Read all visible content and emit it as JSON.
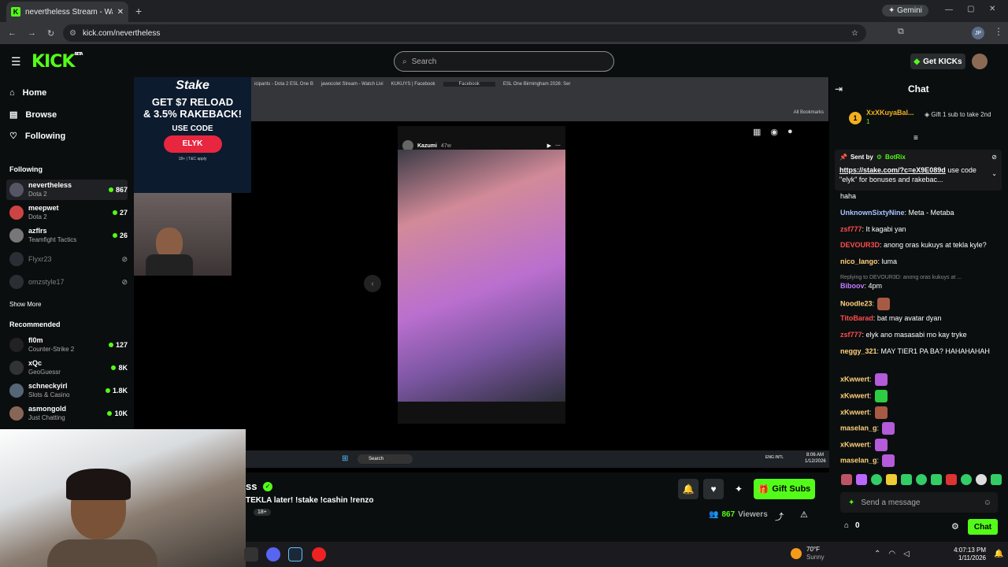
{
  "browser": {
    "tab_title": "nevertheless Stream - Watch Li",
    "url": "kick.com/nevertheless",
    "gemini_label": "Gemini",
    "profile_initials": "JP"
  },
  "header": {
    "logo": "KICK",
    "logo_badge": "BETA",
    "search_placeholder": "Search",
    "get_kicks_label": "Get KICKs"
  },
  "sidebar": {
    "nav": [
      {
        "label": "Home"
      },
      {
        "label": "Browse"
      },
      {
        "label": "Following"
      }
    ],
    "following_heading": "Following",
    "following": [
      {
        "name": "nevertheless",
        "category": "Dota 2",
        "viewers": "867",
        "live": true
      },
      {
        "name": "meepwet",
        "category": "Dota 2",
        "viewers": "27",
        "live": true
      },
      {
        "name": "azflrs",
        "category": "Teamfight Tactics",
        "viewers": "26",
        "live": true
      },
      {
        "name": "Flyxr23",
        "category": "",
        "viewers": "",
        "live": false
      },
      {
        "name": "omzstyle17",
        "category": "",
        "viewers": "",
        "live": false
      }
    ],
    "show_more": "Show More",
    "recommended_heading": "Recommended",
    "recommended": [
      {
        "name": "fl0m",
        "category": "Counter-Strike 2",
        "viewers": "127"
      },
      {
        "name": "xQc",
        "category": "GeoGuessr",
        "viewers": "8K"
      },
      {
        "name": "schneckyirl",
        "category": "Slots & Casino",
        "viewers": "1.8K"
      },
      {
        "name": "asmongold",
        "category": "Just Chatting",
        "viewers": "10K"
      }
    ]
  },
  "ad": {
    "brand": "Stake",
    "line1": "GET $7 RELOAD",
    "line2": "& 3.5% RAKEBACK!",
    "use_code": "USE CODE",
    "code": "ELYK",
    "fine_print": "18+ | T&C apply"
  },
  "stream_overlay": {
    "inner_tabs": [
      "icipants - Dota 2 ESL One B",
      "jawocolet Stream - Watch Livi",
      "KUKUYS | Facebook",
      "Facebook",
      "ESL One Birmingham 2026: Ser"
    ],
    "bookmarks": "All Bookmarks",
    "post_author": "Kazumi",
    "post_time": "47w",
    "taskbar_search": "Search",
    "taskbar_time": "8:06 AM",
    "taskbar_date": "1/12/2026",
    "taskbar_lang": "ENG INTL"
  },
  "stream_info": {
    "channel_name_partial": "ss",
    "title": "TEKLA later! !stake !cashin !renzo",
    "age_badge": "18+",
    "viewers": "867",
    "viewers_label": "Viewers",
    "gift_subs_label": "Gift Subs"
  },
  "chat": {
    "heading": "Chat",
    "top_gifter": {
      "rank": "1",
      "name": "XxXKuyaBal...",
      "count": "1",
      "note": "Gift 1 sub to take 2nd"
    },
    "pinned": {
      "sent_by": "Sent by",
      "bot": "BotRix",
      "link": "https://stake.com/?c=eX9E089d",
      "text": " use code \"elyk\" for bonuses and rakebac..."
    },
    "messages": [
      {
        "user": "",
        "text": "haha",
        "color": "#ffffff"
      },
      {
        "user": "UnknownSixtyNine",
        "text": ": Meta - Metaba",
        "color": "#a8c5ff"
      },
      {
        "user": "zsf777",
        "text": ": It kagabi yan",
        "color": "#ff4d4d"
      },
      {
        "user": "DEVOUR3D",
        "text": ": anong oras kukuys at tekla kyle?",
        "color": "#ff4d4d"
      },
      {
        "user": "nico_lango",
        "text": ": luma",
        "color": "#ffd27a"
      },
      {
        "user": "Replying to DEVOUR3D: anong oras kukuys at ...",
        "text": "",
        "color": "#888888"
      },
      {
        "user": "Biboov",
        "text": ": 4pm",
        "color": "#c27bff"
      },
      {
        "user": "Noodle23",
        "text": ":",
        "color": "#ffd27a"
      },
      {
        "user": "TitoBarad",
        "text": ": bat may avatar dyan",
        "color": "#ff4d4d"
      },
      {
        "user": "zsf777",
        "text": ": elyk ano masasabi mo kay tryke",
        "color": "#ff4d4d"
      },
      {
        "user": "neggy_321",
        "text": ": MAY TIER1 PA BA? HAHAHAHAH",
        "color": "#ffd27a"
      },
      {
        "user": "xKwwert",
        "text": ":",
        "color": "#ffd27a"
      },
      {
        "user": "xKwwert",
        "text": ":",
        "color": "#ffd27a"
      },
      {
        "user": "xKwwert",
        "text": ":",
        "color": "#ffd27a"
      },
      {
        "user": "maselan_g",
        "text": ":",
        "color": "#ffd27a"
      },
      {
        "user": "xKwwert",
        "text": ":",
        "color": "#ffd27a"
      },
      {
        "user": "maselan_g",
        "text": ":",
        "color": "#ffd27a"
      }
    ],
    "input_placeholder": "Send a message",
    "points": "0",
    "chat_button": "Chat"
  },
  "windows_taskbar": {
    "weather_temp": "70°F",
    "weather_desc": "Sunny",
    "time": "4:07:13 PM",
    "date": "1/11/2026"
  },
  "colors": {
    "accent": "#53fc18",
    "bg": "#0b0e0f"
  }
}
